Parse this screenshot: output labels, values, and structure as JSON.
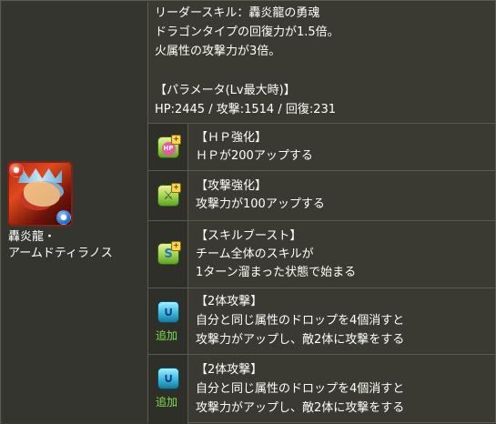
{
  "monster": {
    "name_line1": "轟炎龍・",
    "name_line2": "アームドティラノス",
    "attribute_main_icon": "fire-orb-icon",
    "attribute_sub_icon": "water-orb-icon"
  },
  "leader_skill": {
    "line1": "リーダースキル：轟炎龍の勇魂",
    "line2": "ドラゴンタイプの回復力が1.5倍。",
    "line3": "火属性の攻撃力が3倍。",
    "param_heading": "【パラメータ(Lv最大時)】",
    "params": "HP:2445 / 攻撃:1514 / 回復:231"
  },
  "awakenings": [
    {
      "icon": "hp-enhance-icon",
      "glyph": "HP",
      "title": "【ＨＰ強化】",
      "desc": [
        "ＨＰが200アップする"
      ]
    },
    {
      "icon": "attack-enhance-icon",
      "glyph": "⚔",
      "title": "【攻撃強化】",
      "desc": [
        "攻撃力が100アップする"
      ]
    },
    {
      "icon": "skill-boost-icon",
      "glyph": "S",
      "title": "【スキルブースト】",
      "desc": [
        "チーム全体のスキルが",
        "1ターン溜まった状態で始まる"
      ]
    },
    {
      "icon": "two-way-attack-icon",
      "glyph": "∪",
      "added": "追加",
      "title": "【2体攻撃】",
      "desc": [
        "自分と同じ属性のドロップを4個消すと",
        "攻撃力がアップし、敵2体に攻撃をする"
      ]
    },
    {
      "icon": "two-way-attack-icon",
      "glyph": "∪",
      "added": "追加",
      "title": "【2体攻撃】",
      "desc": [
        "自分と同じ属性のドロップを4個消すと",
        "攻撃力がアップし、敵2体に攻撃をする"
      ]
    }
  ]
}
